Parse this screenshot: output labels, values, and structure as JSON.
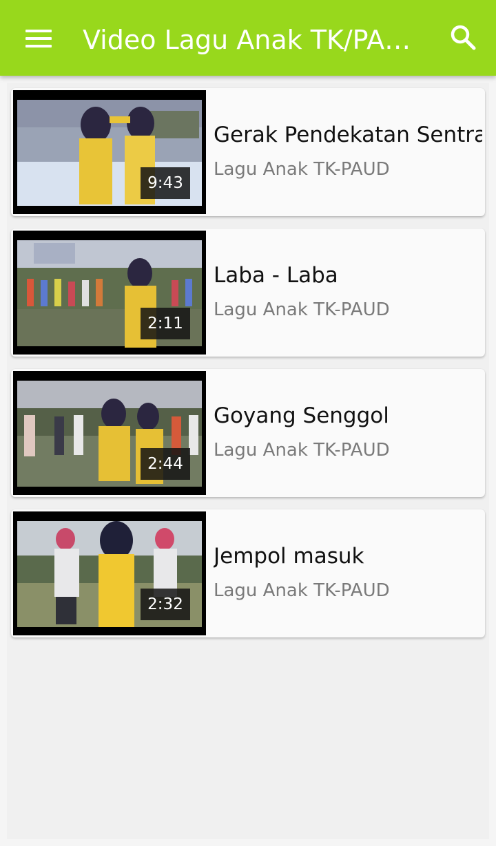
{
  "appbar": {
    "title": "Video Lagu Anak TK/PAUD",
    "menu_icon": "hamburger-menu-icon",
    "search_icon": "search-icon",
    "color": "#98d81c"
  },
  "videos": [
    {
      "title": "Gerak Pendekatan Sentra",
      "channel": "Lagu Anak TK-PAUD",
      "duration": "9:43"
    },
    {
      "title": "Laba - Laba",
      "channel": "Lagu Anak TK-PAUD",
      "duration": "2:11"
    },
    {
      "title": "Goyang Senggol",
      "channel": "Lagu Anak TK-PAUD",
      "duration": "2:44"
    },
    {
      "title": "Jempol masuk",
      "channel": "Lagu Anak TK-PAUD",
      "duration": "2:32"
    }
  ]
}
